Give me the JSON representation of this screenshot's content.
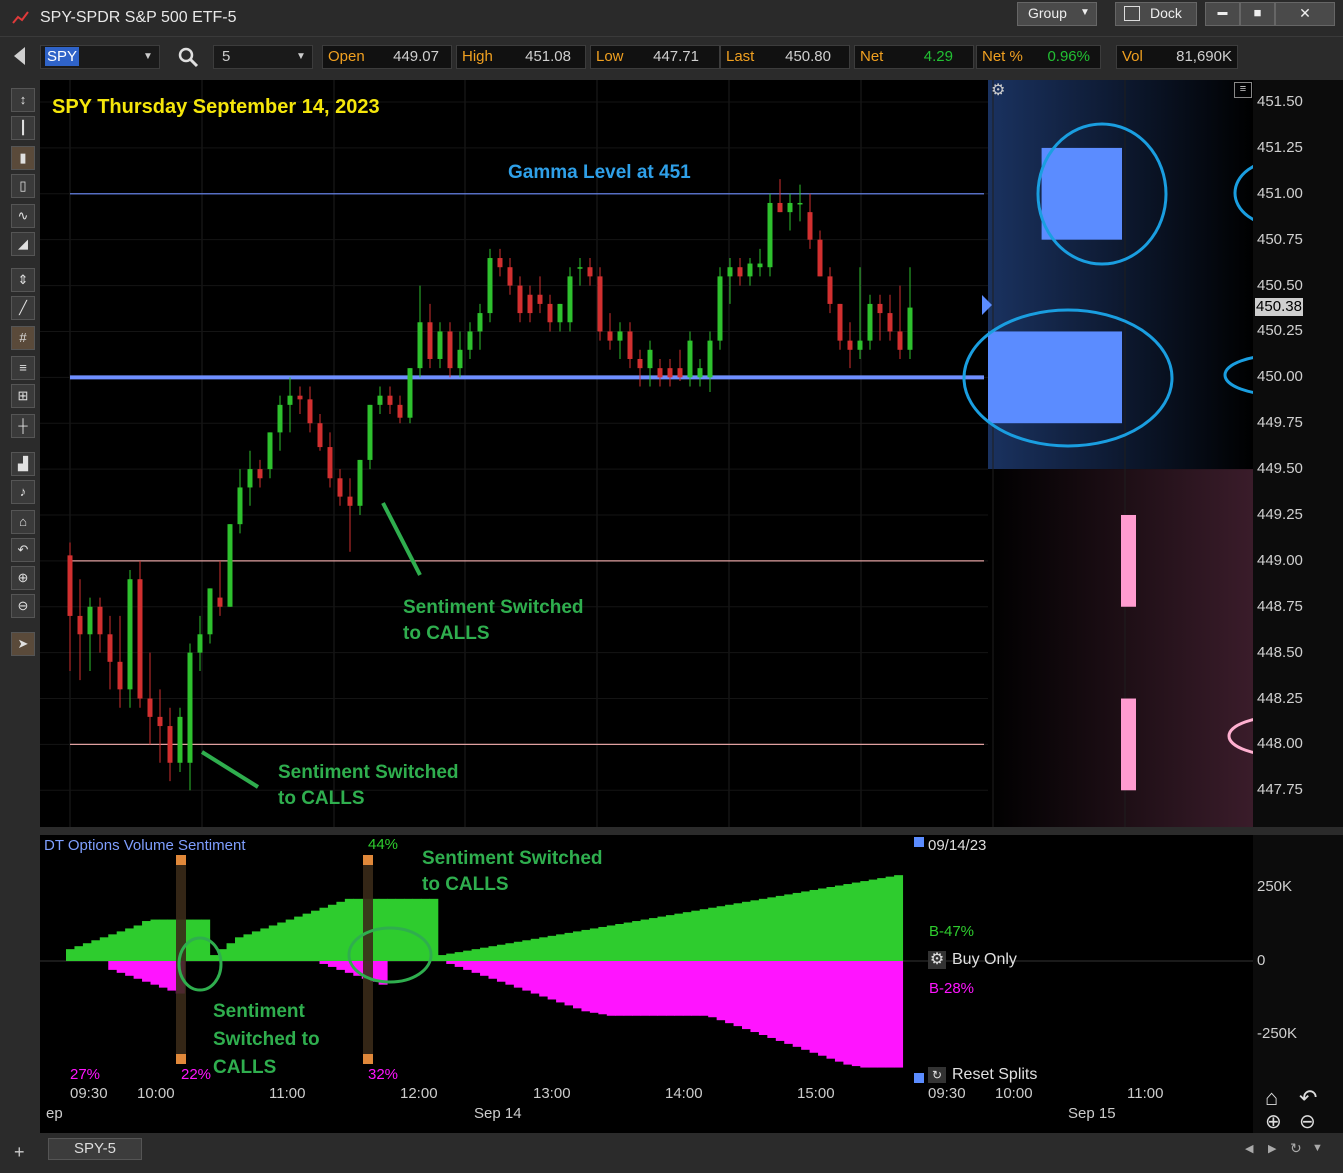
{
  "window": {
    "title": "SPY-SPDR S&P 500 ETF-5",
    "group_label": "Group",
    "dock_label": "Dock",
    "minimize_glyph": "▬",
    "maximize_glyph": "■",
    "close_glyph": "✕"
  },
  "quote": {
    "symbol": "SPY",
    "interval": "5",
    "open_label": "Open",
    "open": "449.07",
    "high_label": "High",
    "high": "451.08",
    "low_label": "Low",
    "low": "447.71",
    "last_label": "Last",
    "last": "450.80",
    "net_label": "Net",
    "net": "4.29",
    "netpct_label": "Net %",
    "netpct": "0.96%",
    "vol_label": "Vol",
    "vol": "81,690K"
  },
  "chart": {
    "heading": "SPY Thursday September 14, 2023",
    "gamma_label": "Gamma Level at 451",
    "annotation_calls": "Sentiment Switched",
    "annotation_calls_2": "to CALLS",
    "sub_annotation_1": "Sentiment",
    "sub_annotation_2": "Switched to",
    "sub_annotation_3": "CALLS",
    "current_price_tag": "450.38"
  },
  "price_axis": [
    "451.50",
    "451.25",
    "451.00",
    "450.75",
    "450.50",
    "450.25",
    "450.00",
    "449.75",
    "449.50",
    "449.25",
    "449.00",
    "448.75",
    "448.50",
    "448.25",
    "448.00",
    "447.75"
  ],
  "sub_chart": {
    "title": "DT Options Volume Sentiment",
    "date_label": "09/14/23",
    "b_pos": "B-47%",
    "b_neg": "B-28%",
    "buy_only": "Buy Only",
    "reset_splits": "Reset Splits",
    "pct_27": "27%",
    "pct_22": "22%",
    "pct_44": "44%",
    "pct_32": "32%",
    "axis": [
      "250K",
      "0",
      "-250K"
    ]
  },
  "time_axis": {
    "ticks": [
      "09:30",
      "10:00",
      "11:00",
      "12:00",
      "13:00",
      "14:00",
      "15:00",
      "09:30",
      "10:00",
      "11:00"
    ],
    "dates": [
      "ep",
      "Sep 14",
      "Sep 15"
    ]
  },
  "status": {
    "tab": "SPY-5",
    "add_glyph": "+"
  },
  "colors": {
    "up": "#2ec12e",
    "down": "#d23030",
    "gamma_line": "#6f8fff",
    "annotation": "#2fae4e",
    "heading": "#f5e60b",
    "sentiment_pos": "#2ecc2e",
    "sentiment_neg": "#ff14ff"
  },
  "chart_data": {
    "type": "candlestick",
    "interval_minutes": 5,
    "open_time": "09:30",
    "candles": [
      {
        "t": "09:30",
        "o": 449.03,
        "h": 449.1,
        "l": 448.4,
        "c": 448.7
      },
      {
        "t": "09:35",
        "o": 448.7,
        "h": 448.9,
        "l": 448.35,
        "c": 448.6
      },
      {
        "t": "09:40",
        "o": 448.6,
        "h": 448.8,
        "l": 448.4,
        "c": 448.75
      },
      {
        "t": "09:45",
        "o": 448.75,
        "h": 448.8,
        "l": 448.5,
        "c": 448.6
      },
      {
        "t": "09:50",
        "o": 448.6,
        "h": 448.7,
        "l": 448.3,
        "c": 448.45
      },
      {
        "t": "09:55",
        "o": 448.45,
        "h": 448.7,
        "l": 448.2,
        "c": 448.3
      },
      {
        "t": "10:00",
        "o": 448.3,
        "h": 448.95,
        "l": 448.2,
        "c": 448.9
      },
      {
        "t": "10:05",
        "o": 448.9,
        "h": 449.0,
        "l": 448.2,
        "c": 448.25
      },
      {
        "t": "10:10",
        "o": 448.25,
        "h": 448.5,
        "l": 448.0,
        "c": 448.15
      },
      {
        "t": "10:15",
        "o": 448.15,
        "h": 448.3,
        "l": 447.9,
        "c": 448.1
      },
      {
        "t": "10:20",
        "o": 448.1,
        "h": 448.2,
        "l": 447.8,
        "c": 447.9
      },
      {
        "t": "10:25",
        "o": 447.9,
        "h": 448.2,
        "l": 447.85,
        "c": 448.15
      },
      {
        "t": "10:30",
        "o": 447.9,
        "h": 448.55,
        "l": 447.75,
        "c": 448.5
      },
      {
        "t": "10:35",
        "o": 448.5,
        "h": 448.7,
        "l": 448.4,
        "c": 448.6
      },
      {
        "t": "10:40",
        "o": 448.6,
        "h": 448.85,
        "l": 448.55,
        "c": 448.85
      },
      {
        "t": "10:45",
        "o": 448.8,
        "h": 449.0,
        "l": 448.7,
        "c": 448.75
      },
      {
        "t": "10:50",
        "o": 448.75,
        "h": 449.2,
        "l": 448.75,
        "c": 449.2
      },
      {
        "t": "10:55",
        "o": 449.2,
        "h": 449.5,
        "l": 449.15,
        "c": 449.4
      },
      {
        "t": "11:00",
        "o": 449.4,
        "h": 449.6,
        "l": 449.3,
        "c": 449.5
      },
      {
        "t": "11:05",
        "o": 449.5,
        "h": 449.55,
        "l": 449.4,
        "c": 449.45
      },
      {
        "t": "11:10",
        "o": 449.5,
        "h": 449.7,
        "l": 449.45,
        "c": 449.7
      },
      {
        "t": "11:15",
        "o": 449.7,
        "h": 449.9,
        "l": 449.6,
        "c": 449.85
      },
      {
        "t": "11:20",
        "o": 449.85,
        "h": 450.0,
        "l": 449.7,
        "c": 449.9
      },
      {
        "t": "11:25",
        "o": 449.9,
        "h": 449.95,
        "l": 449.8,
        "c": 449.88
      },
      {
        "t": "11:30",
        "o": 449.88,
        "h": 449.95,
        "l": 449.7,
        "c": 449.75
      },
      {
        "t": "11:35",
        "o": 449.75,
        "h": 449.8,
        "l": 449.6,
        "c": 449.62
      },
      {
        "t": "11:40",
        "o": 449.62,
        "h": 449.7,
        "l": 449.4,
        "c": 449.45
      },
      {
        "t": "11:45",
        "o": 449.45,
        "h": 449.5,
        "l": 449.3,
        "c": 449.35
      },
      {
        "t": "11:50",
        "o": 449.35,
        "h": 449.45,
        "l": 449.05,
        "c": 449.3
      },
      {
        "t": "11:55",
        "o": 449.3,
        "h": 449.55,
        "l": 449.25,
        "c": 449.55
      },
      {
        "t": "12:00",
        "o": 449.55,
        "h": 449.85,
        "l": 449.5,
        "c": 449.85
      },
      {
        "t": "12:05",
        "o": 449.85,
        "h": 449.95,
        "l": 449.8,
        "c": 449.9
      },
      {
        "t": "12:10",
        "o": 449.9,
        "h": 449.95,
        "l": 449.8,
        "c": 449.85
      },
      {
        "t": "12:15",
        "o": 449.85,
        "h": 449.9,
        "l": 449.75,
        "c": 449.78
      },
      {
        "t": "12:20",
        "o": 449.78,
        "h": 450.05,
        "l": 449.75,
        "c": 450.05
      },
      {
        "t": "12:25",
        "o": 450.05,
        "h": 450.5,
        "l": 450.0,
        "c": 450.3
      },
      {
        "t": "12:30",
        "o": 450.3,
        "h": 450.4,
        "l": 450.05,
        "c": 450.1
      },
      {
        "t": "12:35",
        "o": 450.1,
        "h": 450.3,
        "l": 450.05,
        "c": 450.25
      },
      {
        "t": "12:40",
        "o": 450.25,
        "h": 450.3,
        "l": 450.0,
        "c": 450.05
      },
      {
        "t": "12:45",
        "o": 450.05,
        "h": 450.25,
        "l": 450.0,
        "c": 450.15
      },
      {
        "t": "12:50",
        "o": 450.15,
        "h": 450.3,
        "l": 450.1,
        "c": 450.25
      },
      {
        "t": "12:55",
        "o": 450.25,
        "h": 450.4,
        "l": 450.15,
        "c": 450.35
      },
      {
        "t": "13:00",
        "o": 450.35,
        "h": 450.7,
        "l": 450.3,
        "c": 450.65
      },
      {
        "t": "13:05",
        "o": 450.65,
        "h": 450.7,
        "l": 450.55,
        "c": 450.6
      },
      {
        "t": "13:10",
        "o": 450.6,
        "h": 450.65,
        "l": 450.45,
        "c": 450.5
      },
      {
        "t": "13:15",
        "o": 450.5,
        "h": 450.55,
        "l": 450.3,
        "c": 450.35
      },
      {
        "t": "13:20",
        "o": 450.45,
        "h": 450.5,
        "l": 450.3,
        "c": 450.35
      },
      {
        "t": "13:25",
        "o": 450.45,
        "h": 450.55,
        "l": 450.35,
        "c": 450.4
      },
      {
        "t": "13:30",
        "o": 450.4,
        "h": 450.45,
        "l": 450.25,
        "c": 450.3
      },
      {
        "t": "13:35",
        "o": 450.3,
        "h": 450.4,
        "l": 450.25,
        "c": 450.4
      },
      {
        "t": "13:40",
        "o": 450.3,
        "h": 450.6,
        "l": 450.25,
        "c": 450.55
      },
      {
        "t": "13:45",
        "o": 450.6,
        "h": 450.65,
        "l": 450.5,
        "c": 450.6
      },
      {
        "t": "13:50",
        "o": 450.6,
        "h": 450.65,
        "l": 450.5,
        "c": 450.55
      },
      {
        "t": "13:55",
        "o": 450.55,
        "h": 450.6,
        "l": 450.2,
        "c": 450.25
      },
      {
        "t": "14:00",
        "o": 450.25,
        "h": 450.35,
        "l": 450.15,
        "c": 450.2
      },
      {
        "t": "14:05",
        "o": 450.2,
        "h": 450.3,
        "l": 450.1,
        "c": 450.25
      },
      {
        "t": "14:10",
        "o": 450.25,
        "h": 450.3,
        "l": 450.05,
        "c": 450.1
      },
      {
        "t": "14:15",
        "o": 450.1,
        "h": 450.15,
        "l": 449.95,
        "c": 450.05
      },
      {
        "t": "14:20",
        "o": 450.05,
        "h": 450.2,
        "l": 449.95,
        "c": 450.15
      },
      {
        "t": "14:25",
        "o": 450.05,
        "h": 450.1,
        "l": 449.95,
        "c": 450.0
      },
      {
        "t": "14:30",
        "o": 450.05,
        "h": 450.1,
        "l": 449.95,
        "c": 450.0
      },
      {
        "t": "14:35",
        "o": 450.05,
        "h": 450.15,
        "l": 449.98,
        "c": 450.0
      },
      {
        "t": "14:40",
        "o": 450.0,
        "h": 450.25,
        "l": 449.95,
        "c": 450.2
      },
      {
        "t": "14:45",
        "o": 450.0,
        "h": 450.1,
        "l": 449.95,
        "c": 450.05
      },
      {
        "t": "14:50",
        "o": 450.0,
        "h": 450.25,
        "l": 449.92,
        "c": 450.2
      },
      {
        "t": "14:55",
        "o": 450.2,
        "h": 450.6,
        "l": 450.15,
        "c": 450.55
      },
      {
        "t": "15:00",
        "o": 450.55,
        "h": 450.65,
        "l": 450.4,
        "c": 450.6
      },
      {
        "t": "15:05",
        "o": 450.6,
        "h": 450.65,
        "l": 450.5,
        "c": 450.55
      },
      {
        "t": "15:10",
        "o": 450.55,
        "h": 450.65,
        "l": 450.5,
        "c": 450.62
      },
      {
        "t": "15:15",
        "o": 450.6,
        "h": 450.7,
        "l": 450.55,
        "c": 450.62
      },
      {
        "t": "15:20",
        "o": 450.6,
        "h": 451.0,
        "l": 450.55,
        "c": 450.95
      },
      {
        "t": "15:25",
        "o": 450.95,
        "h": 451.08,
        "l": 450.9,
        "c": 450.9
      },
      {
        "t": "15:30",
        "o": 450.9,
        "h": 451.0,
        "l": 450.8,
        "c": 450.95
      },
      {
        "t": "15:35",
        "o": 450.95,
        "h": 451.05,
        "l": 450.85,
        "c": 450.95
      },
      {
        "t": "15:40",
        "o": 450.9,
        "h": 451.0,
        "l": 450.7,
        "c": 450.75
      },
      {
        "t": "15:45",
        "o": 450.75,
        "h": 450.8,
        "l": 450.55,
        "c": 450.55
      },
      {
        "t": "15:50",
        "o": 450.55,
        "h": 450.6,
        "l": 450.35,
        "c": 450.4
      },
      {
        "t": "15:55",
        "o": 450.4,
        "h": 450.4,
        "l": 450.15,
        "c": 450.2
      },
      {
        "t": "16:00",
        "o": 450.2,
        "h": 450.3,
        "l": 450.05,
        "c": 450.15
      },
      {
        "t": "16:05",
        "o": 450.15,
        "h": 450.6,
        "l": 450.1,
        "c": 450.2
      },
      {
        "t": "16:10",
        "o": 450.2,
        "h": 450.45,
        "l": 450.15,
        "c": 450.4
      },
      {
        "t": "16:15",
        "o": 450.4,
        "h": 450.45,
        "l": 450.2,
        "c": 450.35
      },
      {
        "t": "16:20",
        "o": 450.35,
        "h": 450.45,
        "l": 450.2,
        "c": 450.25
      },
      {
        "t": "16:25",
        "o": 450.25,
        "h": 450.5,
        "l": 450.1,
        "c": 450.15
      },
      {
        "t": "16:30",
        "o": 450.15,
        "h": 450.6,
        "l": 450.1,
        "c": 450.38
      }
    ],
    "price_lines": [
      {
        "price": 451.0,
        "label": "Gamma Level at 451"
      },
      {
        "price": 450.0
      },
      {
        "price": 449.0
      },
      {
        "price": 448.0
      }
    ],
    "gamma_bars": [
      {
        "price": 451.0,
        "side": "call",
        "size": 0.6
      },
      {
        "price": 450.0,
        "side": "call",
        "size": 1.0
      },
      {
        "price": 449.0,
        "side": "put",
        "size": 0.15
      },
      {
        "price": 448.0,
        "side": "put",
        "size": 0.15
      }
    ],
    "ylim": [
      447.55,
      451.62
    ],
    "sentiment_pos": [
      40,
      50,
      60,
      70,
      80,
      90,
      100,
      110,
      120,
      135,
      140,
      140,
      140,
      140,
      140,
      140,
      140,
      20,
      40,
      60,
      80,
      90,
      100,
      110,
      120,
      130,
      140,
      150,
      160,
      170,
      180,
      190,
      200,
      210,
      210,
      210,
      210,
      210,
      210,
      210,
      210,
      210,
      210,
      210,
      20,
      25,
      30,
      35,
      40,
      45,
      50,
      55,
      60,
      65,
      70,
      75,
      80,
      85,
      90,
      95,
      100,
      105,
      110,
      115,
      120,
      125,
      130,
      135,
      140,
      145,
      150,
      155,
      160,
      165,
      170,
      175,
      180,
      185,
      190,
      195,
      200,
      205,
      210,
      215,
      220,
      225,
      230,
      235,
      240,
      245,
      250,
      255,
      260,
      265,
      270,
      275,
      280,
      285,
      290
    ],
    "sentiment_neg": [
      0,
      0,
      0,
      0,
      0,
      30,
      40,
      50,
      60,
      70,
      80,
      90,
      100,
      110,
      0,
      0,
      0,
      0,
      0,
      0,
      0,
      0,
      0,
      0,
      0,
      0,
      0,
      0,
      0,
      0,
      10,
      20,
      30,
      40,
      50,
      60,
      70,
      80,
      0,
      0,
      0,
      0,
      0,
      0,
      0,
      10,
      20,
      30,
      40,
      50,
      60,
      70,
      80,
      90,
      100,
      110,
      120,
      130,
      140,
      150,
      160,
      170,
      175,
      180,
      185,
      185,
      185,
      185,
      185,
      185,
      185,
      185,
      185,
      185,
      185,
      185,
      190,
      200,
      210,
      220,
      230,
      240,
      250,
      260,
      270,
      280,
      290,
      300,
      310,
      320,
      330,
      340,
      350,
      355,
      360,
      360,
      360,
      360,
      360
    ],
    "sentiment_pct": {
      "start_pos": "27%",
      "marker1": "22%",
      "marker2_pos": "44%",
      "marker2_neg": "32%"
    }
  }
}
